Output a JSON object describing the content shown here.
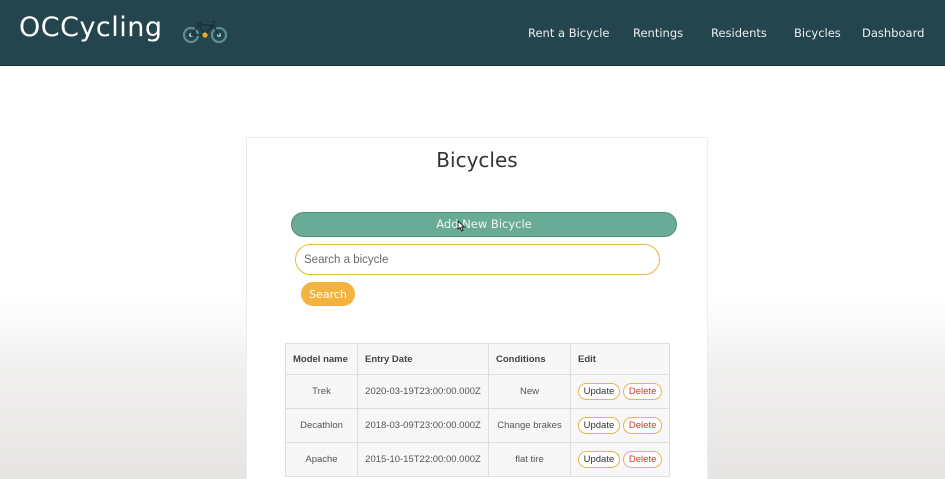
{
  "navbar": {
    "brand": "OCCycling",
    "brand_icon": "bicycle-icon",
    "links": [
      {
        "label": "Rent a Bicycle"
      },
      {
        "label": "Rentings"
      },
      {
        "label": "Residents"
      },
      {
        "label": "Bicycles"
      },
      {
        "label": "Dashboard"
      }
    ]
  },
  "main": {
    "title": "Bicycles",
    "add_button_label": "Add New Bicycle",
    "search": {
      "placeholder": "Search a bicycle",
      "value": "",
      "button_label": "Search"
    },
    "table": {
      "headers": [
        "Model name",
        "Entry Date",
        "Conditions",
        "Edit"
      ],
      "rows": [
        {
          "model": "Trek",
          "entry_date": "2020-03-19T23:00:00.000Z",
          "condition": "New",
          "update_label": "Update",
          "delete_label": "Delete"
        },
        {
          "model": "Decathlon",
          "entry_date": "2018-03-09T23:00:00.000Z",
          "condition": "Change brakes",
          "update_label": "Update",
          "delete_label": "Delete"
        },
        {
          "model": "Apache",
          "entry_date": "2015-10-15T22:00:00.000Z",
          "condition": "flat tire",
          "update_label": "Update",
          "delete_label": "Delete"
        }
      ]
    }
  },
  "colors": {
    "navbar": "#25454e",
    "add_button": "#6aab98",
    "accent_orange": "#f3b43f",
    "delete_text": "#d0392b"
  }
}
